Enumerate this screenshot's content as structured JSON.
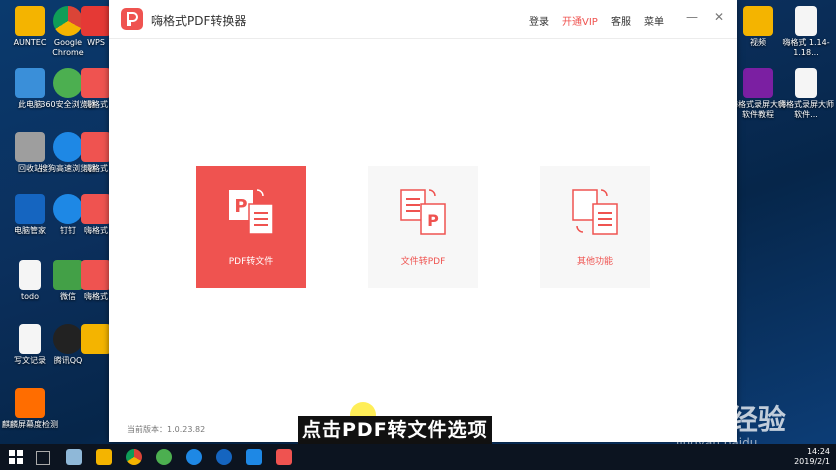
{
  "desktop": {
    "left_icons": [
      {
        "label": "AUNTEC",
        "color": "#f4b400"
      },
      {
        "label": "Google Chrome",
        "color": "#e8e8e8"
      },
      {
        "label": "WPS",
        "color": "#e53935"
      },
      {
        "label": "此电脑",
        "color": "#3a8fd9"
      },
      {
        "label": "360安全浏览器",
        "color": "#4caf50"
      },
      {
        "label": "嗨格式",
        "color": "#ef5350"
      },
      {
        "label": "回收站",
        "color": "#9e9e9e"
      },
      {
        "label": "搜狗高速浏览器",
        "color": "#1e88e5"
      },
      {
        "label": "嗨格式",
        "color": "#ef5350"
      },
      {
        "label": "电脑管家",
        "color": "#1565c0"
      },
      {
        "label": "钉钉",
        "color": "#1e88e5"
      },
      {
        "label": "嗨格式",
        "color": "#ef5350"
      },
      {
        "label": "todo",
        "color": "#f5f5f5"
      },
      {
        "label": "微信",
        "color": "#43a047"
      },
      {
        "label": "嗨格式",
        "color": "#ef5350"
      },
      {
        "label": "写文记录",
        "color": "#f5f5f5"
      },
      {
        "label": "腾讯QQ",
        "color": "#222222"
      },
      {
        "label": "",
        "color": "#f4b400"
      },
      {
        "label": "麒麟屏幕度检测",
        "color": "#ff6d00"
      }
    ],
    "right_icons": [
      {
        "label": "视频",
        "color": "#f4b400"
      },
      {
        "label": "嗨格式 1.14-1.18...",
        "color": "#f5f5f5"
      },
      {
        "label": "嗨格式录屏大师软件教程",
        "color": "#7b1fa2"
      },
      {
        "label": "嗨格式录屏大师软件...",
        "color": "#f5f5f5"
      }
    ]
  },
  "window": {
    "title": "嗨格式PDF转换器",
    "menu": {
      "login": "登录",
      "vip": "开通VIP",
      "service": "客服",
      "menu": "菜单"
    },
    "controls": {
      "minimize": "—",
      "close": "✕"
    },
    "cards": [
      {
        "label": "PDF转文件",
        "active": true
      },
      {
        "label": "文件转PDF",
        "active": false
      },
      {
        "label": "其他功能",
        "active": false
      }
    ],
    "version": "当前版本：1.0.23.82",
    "accent": "#ef5350"
  },
  "overlay": {
    "caption": "点击PDF转文件选项",
    "watermark": "Baidu经验",
    "watermark_url": "jingyan.baidu"
  },
  "taskbar": {
    "time": "14:24",
    "date": "2019/2/1"
  }
}
